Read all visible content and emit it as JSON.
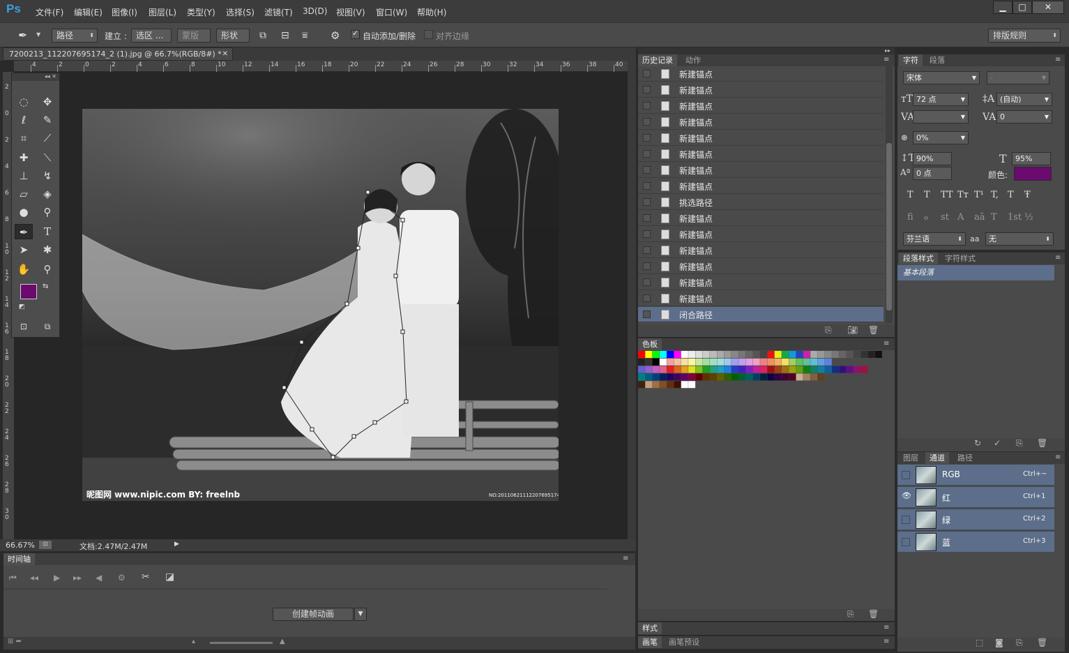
{
  "app": {
    "logo": "Ps"
  },
  "menu": [
    "文件(F)",
    "编辑(E)",
    "图像(I)",
    "图层(L)",
    "类型(Y)",
    "选择(S)",
    "滤镜(T)",
    "3D(D)",
    "视图(V)",
    "窗口(W)",
    "帮助(H)"
  ],
  "window_controls": {
    "minimize": "▁",
    "maximize": "□",
    "close": "✕"
  },
  "options": {
    "mode": "路径",
    "build_label": "建立 :",
    "selection_btn": "选区 ...",
    "mask_btn": "蒙版",
    "shape_btn": "形状",
    "auto_add_delete": "自动添加/删除",
    "align_edges": "对齐边缘",
    "workspace": "排版规则"
  },
  "document": {
    "tab_title": "7200213_112207695174_2 (1).jpg @ 66.7%(RGB/8#) *",
    "zoom": "66.67%",
    "doc_size": "文档:2.47M/2.47M",
    "ruler_h": [
      "4",
      "2",
      "0",
      "2",
      "4",
      "6",
      "8",
      "10",
      "12",
      "14",
      "16",
      "18",
      "20",
      "22",
      "24",
      "26",
      "28",
      "30",
      "32",
      "34",
      "36",
      "38",
      "40"
    ],
    "ruler_v": [
      "2",
      "0",
      "2",
      "4",
      "6",
      "8",
      "1 0",
      "1 2",
      "1 4",
      "1 6",
      "1 8",
      "2 0",
      "2 2",
      "2 4",
      "2 6",
      "2 8",
      "3 0"
    ],
    "watermark_left": "昵图网 www.nipic.com  BY: freelnb",
    "watermark_right": "NO:20110621112207695174"
  },
  "colors": {
    "foreground": "#6b0a6f",
    "background": "#ffffff",
    "accent_select": "#5c6e8a"
  },
  "timeline": {
    "tab": "时间轴",
    "create_btn": "创建帧动画"
  },
  "history": {
    "tabs": [
      "历史记录",
      "动作"
    ],
    "items": [
      "新建锚点",
      "新建锚点",
      "新建锚点",
      "新建锚点",
      "新建锚点",
      "新建锚点",
      "新建锚点",
      "新建锚点",
      "挑选路径",
      "新建锚点",
      "新建锚点",
      "新建锚点",
      "新建锚点",
      "新建锚点",
      "新建锚点",
      "闭合路径"
    ],
    "selected_index": 15
  },
  "swatches": {
    "tab": "色板",
    "tab2": "样式",
    "tab3": "画笔",
    "tab4": "画笔预设"
  },
  "character": {
    "tabs": [
      "字符",
      "段落"
    ],
    "font_family": "宋体",
    "font_style": "-",
    "size": "72 点",
    "leading": "(自动)",
    "kerning": "",
    "tracking": "0",
    "scale_pct": "0%",
    "vscale": "90%",
    "hscale": "95%",
    "baseline": "0 点",
    "color_label": "颜色:",
    "language": "芬兰语",
    "aa_label": "aa",
    "antialias": "无",
    "style_row1": [
      "T",
      "T",
      "TT",
      "Tт",
      "T¹",
      "T,",
      "T",
      "Ŧ"
    ],
    "style_row2": [
      "fi",
      "ℴ",
      "st",
      "A",
      "aā",
      "T",
      "1st",
      "½"
    ]
  },
  "paragraph_styles": {
    "tabs": [
      "段落样式",
      "字符样式"
    ],
    "items": [
      "基本段落"
    ]
  },
  "channels": {
    "tabs": [
      "图层",
      "通道",
      "路径"
    ],
    "items": [
      {
        "name": "RGB",
        "shortcut": "Ctrl+~"
      },
      {
        "name": "红",
        "shortcut": "Ctrl+1"
      },
      {
        "name": "绿",
        "shortcut": "Ctrl+2"
      },
      {
        "name": "蓝",
        "shortcut": "Ctrl+3"
      }
    ]
  }
}
